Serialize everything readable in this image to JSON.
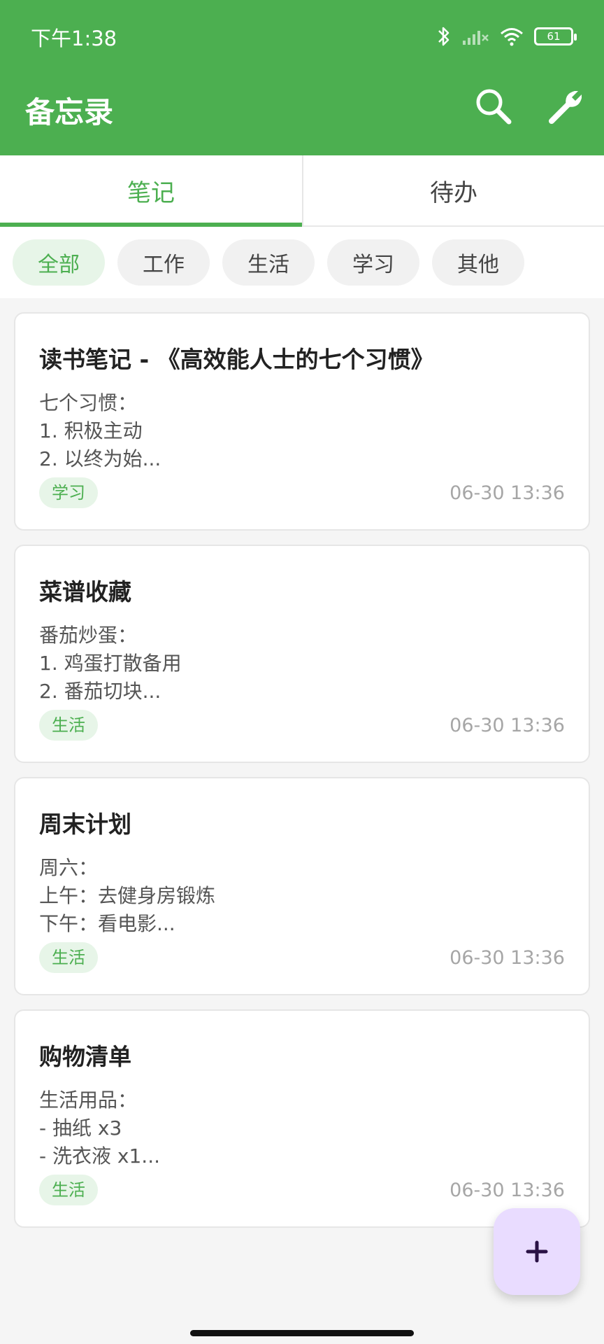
{
  "status_bar": {
    "time": "下午1:38",
    "battery": "61",
    "icons": [
      "bluetooth-icon",
      "signal-icon",
      "wifi-icon",
      "battery-icon"
    ]
  },
  "app_bar": {
    "title": "备忘录",
    "actions": [
      "search-icon",
      "wrench-icon"
    ]
  },
  "tabs": [
    {
      "label": "笔记",
      "active": true
    },
    {
      "label": "待办",
      "active": false
    }
  ],
  "filters": [
    "全部",
    "工作",
    "生活",
    "学习",
    "其他"
  ],
  "notes": [
    {
      "title": "读书笔记 - 《高效能人士的七个习惯》",
      "body": "七个习惯：\n1. 积极主动\n2. 以终为始...",
      "tag": "学习",
      "time": "06-30 13:36"
    },
    {
      "title": "菜谱收藏",
      "body": "番茄炒蛋：\n1. 鸡蛋打散备用\n2. 番茄切块...",
      "tag": "生活",
      "time": "06-30 13:36"
    },
    {
      "title": "周末计划",
      "body": "周六：\n上午：去健身房锻炼\n下午：看电影...",
      "tag": "生活",
      "time": "06-30 13:36"
    },
    {
      "title": "购物清单",
      "body": "生活用品：\n- 抽纸 x3\n- 洗衣液 x1...",
      "tag": "生活",
      "time": "06-30 13:36"
    }
  ],
  "fab": {
    "icon": "plus-icon",
    "label": "+"
  },
  "colors": {
    "primary": "#4caf50",
    "fab": "#e9dcff"
  }
}
